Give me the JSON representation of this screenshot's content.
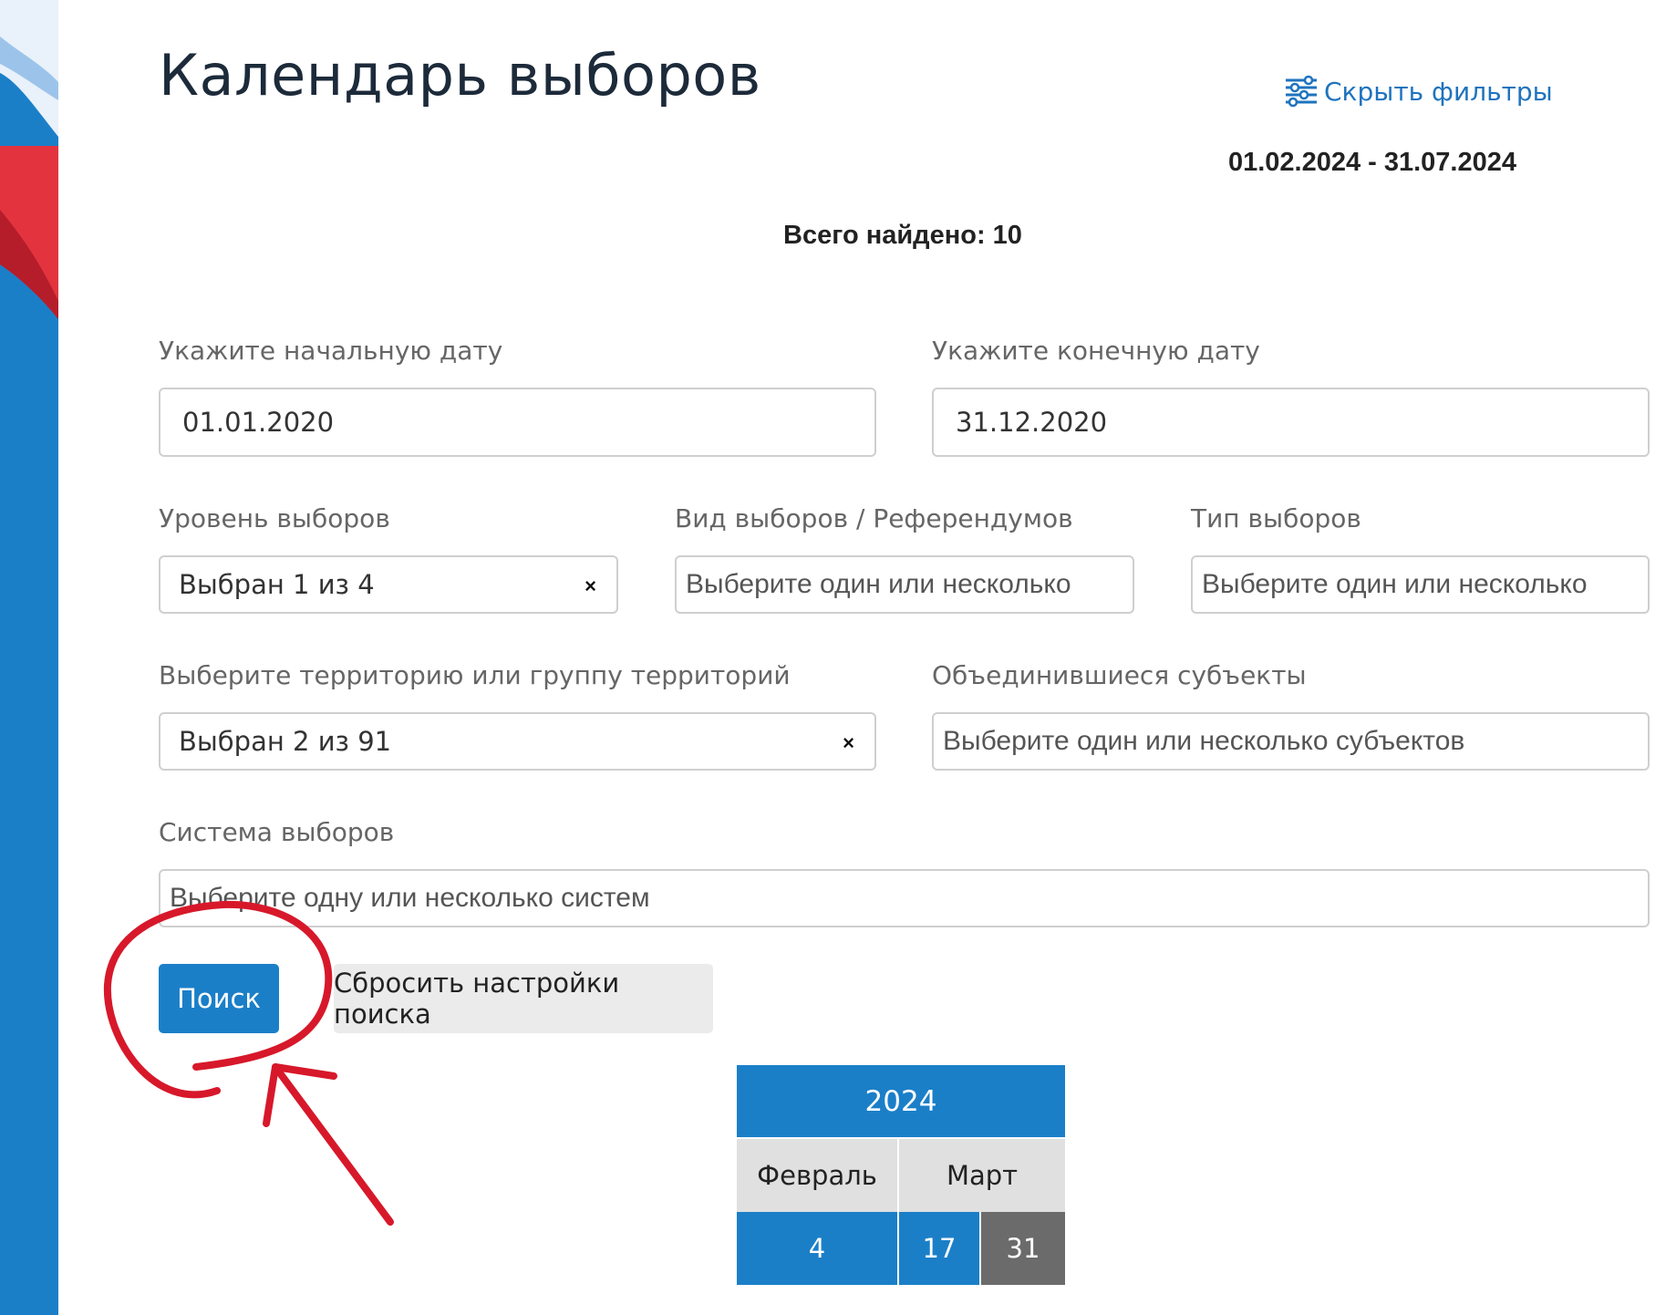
{
  "page": {
    "title": "Календарь выборов",
    "hide_filters_label": "Скрыть фильтры",
    "date_range": "01.02.2024 - 31.07.2024",
    "total_found": "Всего найдено: 10"
  },
  "filters": {
    "start_date": {
      "label": "Укажите начальную дату",
      "value": "01.01.2020"
    },
    "end_date": {
      "label": "Укажите конечную дату",
      "value": "31.12.2020"
    },
    "level": {
      "label": "Уровень выборов",
      "value": "Выбран 1 из 4",
      "clear": "×"
    },
    "kind": {
      "label": "Вид выборов / Референдумов",
      "placeholder": "Выберите один или несколько"
    },
    "type": {
      "label": "Тип выборов",
      "placeholder": "Выберите один или несколько"
    },
    "territory": {
      "label": "Выберите территорию или группу территорий",
      "value": "Выбран 2 из 91",
      "clear": "×"
    },
    "merged_subjects": {
      "label": "Объединившиеся субъекты",
      "placeholder": "Выберите один или несколько субъектов"
    },
    "system": {
      "label": "Система выборов",
      "placeholder": "Выберите одну или несколько систем"
    }
  },
  "buttons": {
    "search": "Поиск",
    "reset": "Сбросить настройки поиска"
  },
  "calendar": {
    "year": "2024",
    "months": [
      "Февраль",
      "Март"
    ],
    "days": [
      "4",
      "17",
      "31"
    ]
  },
  "colors": {
    "primary": "#1b7fc8",
    "annotation": "#d7182a",
    "past_day": "#6b6b6b"
  }
}
